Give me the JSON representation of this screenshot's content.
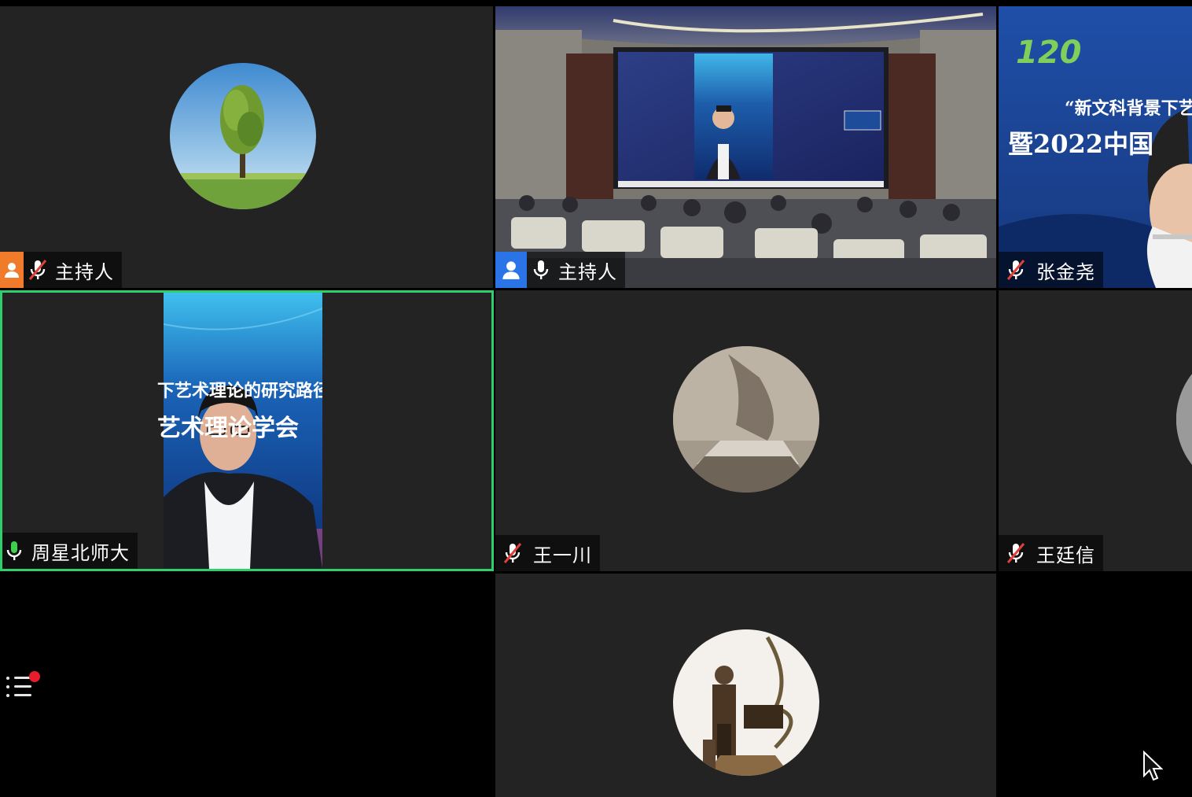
{
  "participants": [
    {
      "name": "主持人",
      "mic": "muted",
      "host": true,
      "host_color": "#f07b2a"
    },
    {
      "name": "主持人",
      "mic": "on",
      "host": true,
      "host_color": "#2b74e8"
    },
    {
      "name": "张金尧",
      "mic": "muted",
      "host": false
    },
    {
      "name": "周星北师大",
      "mic": "speaking",
      "host": false
    },
    {
      "name": "王一川",
      "mic": "muted",
      "host": false
    },
    {
      "name": "王廷信",
      "mic": "muted",
      "host": false
    }
  ],
  "screen_text": {
    "slide_line1": "“新文科背景下艺",
    "slide_line2": "暨2022中国",
    "speaker_bg_line1": "下艺术理论的研究路径",
    "speaker_bg_line2": "艺术理论学会"
  },
  "colors": {
    "tile_bg": "#232323",
    "active_border": "#2fd06b",
    "muted_slash": "#e0403a",
    "speaking": "#3ecf4f",
    "notification_dot": "#e81c2b"
  },
  "icons": {
    "participants_menu": "list-icon",
    "muted_mic": "mic-off-icon",
    "mic": "mic-icon",
    "host": "person-icon",
    "cursor": "mouse-pointer-icon"
  }
}
